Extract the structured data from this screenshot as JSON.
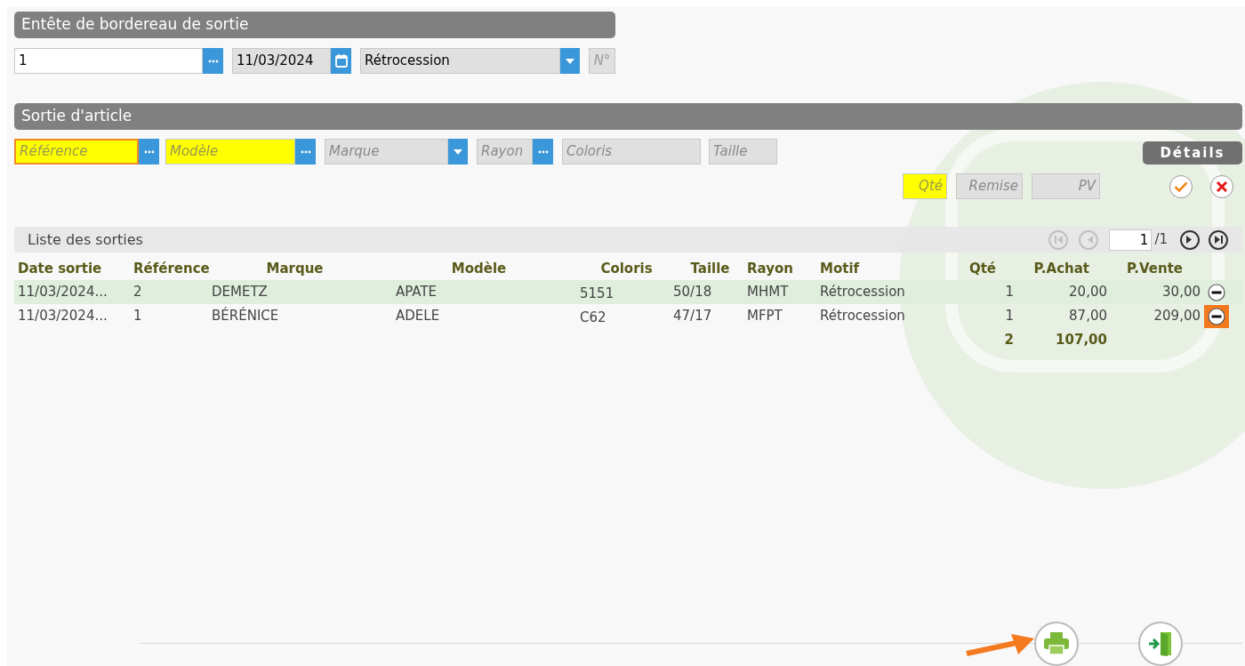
{
  "header_section": {
    "title": "Entête de bordereau de sortie",
    "fields": [
      {
        "kind": "lookup",
        "value": "1",
        "editable": true
      },
      {
        "kind": "date",
        "value": "11/03/2024",
        "editable": false
      },
      {
        "kind": "select",
        "value": "Rétrocession",
        "editable": false
      },
      {
        "kind": "text",
        "placeholder": "N°",
        "editable": false
      }
    ]
  },
  "article_section": {
    "title": "Sortie d'article",
    "fields": [
      {
        "kind": "lookup",
        "placeholder": "Référence",
        "required": true,
        "focused": true
      },
      {
        "kind": "lookup",
        "placeholder": "Modèle",
        "required": true,
        "focused": false
      },
      {
        "kind": "select",
        "placeholder": "Marque",
        "required": false,
        "focused": false
      },
      {
        "kind": "lookup",
        "placeholder": "Rayon",
        "required": false,
        "focused": false
      },
      {
        "kind": "text",
        "placeholder": "Coloris",
        "required": false,
        "focused": false
      },
      {
        "kind": "text",
        "placeholder": "Taille",
        "required": false,
        "focused": false
      }
    ],
    "details_button": "Détails",
    "amount_fields": [
      {
        "placeholder": "Qté",
        "required": true
      },
      {
        "placeholder": "Remise",
        "required": false
      },
      {
        "placeholder": "PV",
        "required": false
      }
    ]
  },
  "list": {
    "title": "Liste des sorties",
    "pager": {
      "page": "1",
      "total": "/1"
    },
    "columns": [
      "Date sortie",
      "Référence",
      "Marque",
      "Modèle",
      "Coloris",
      "Taille",
      "Rayon",
      "Motif",
      "Qté",
      "P.Achat",
      "P.Vente"
    ],
    "rows": [
      {
        "selected": true,
        "highlighted": false,
        "cells": [
          "11/03/2024...",
          "2",
          "DEMETZ",
          "APATE",
          "5151",
          "50/18",
          "MHMT",
          "Rétrocession",
          "1",
          "20,00",
          "30,00"
        ]
      },
      {
        "selected": false,
        "highlighted": true,
        "cells": [
          "11/03/2024...",
          "1",
          "BÉRÉNICE",
          "ADELE",
          "C62",
          "47/17",
          "MFPT",
          "Rétrocession",
          "1",
          "87,00",
          "209,00"
        ]
      }
    ],
    "totals": {
      "quantity": "2",
      "purchase": "107,00"
    }
  }
}
